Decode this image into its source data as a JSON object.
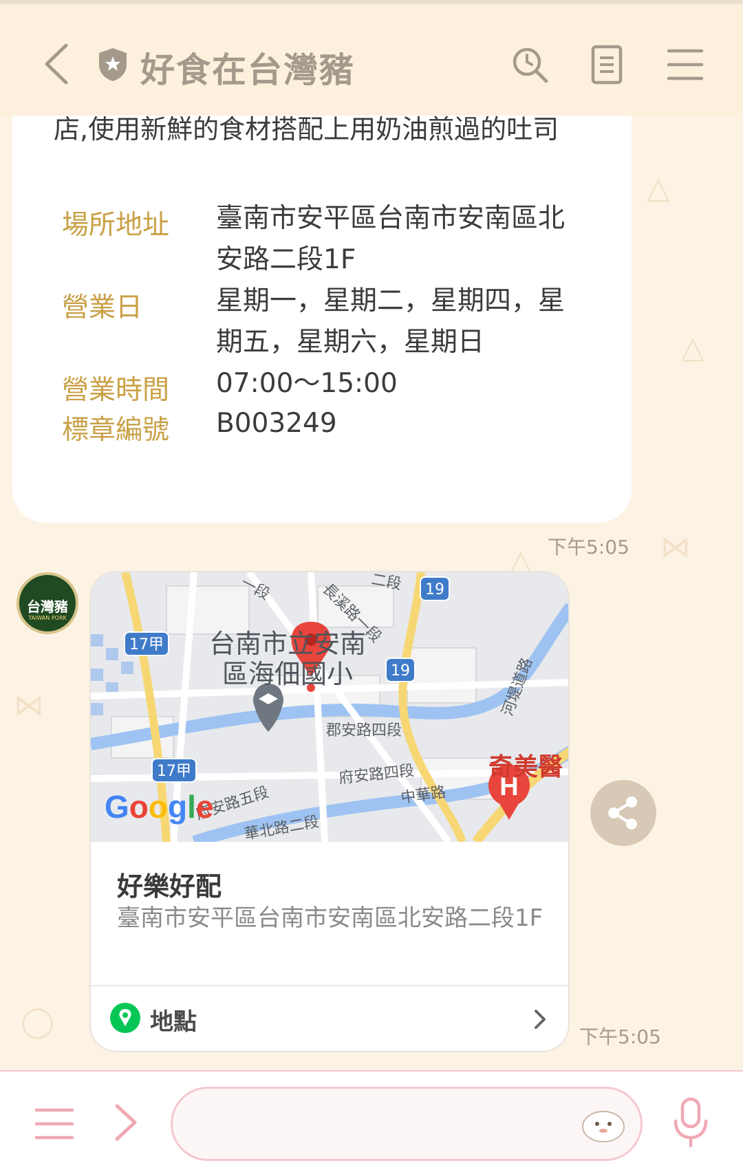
{
  "header": {
    "title": "好食在台灣豬"
  },
  "info_card": {
    "description": "店,使用新鮮的食材搭配上用奶油煎過的吐司",
    "rows": [
      {
        "label": "場所地址",
        "value": "臺南市安平區台南市安南區北安路二段1F"
      },
      {
        "label": "營業日",
        "value": "星期一，星期二，星期四，星期五，星期六，星期日"
      },
      {
        "label": "營業時間",
        "value": "07:00～15:00"
      },
      {
        "label": "標章編號",
        "value": "B003249"
      }
    ],
    "time": "下午5:05"
  },
  "avatar": {
    "text": "台灣豬",
    "sub": "TAIWAN PORK"
  },
  "location_card": {
    "map": {
      "school_name": "台南市立安南區海佃國小",
      "hospital_name": "奇美醫",
      "road_labels": [
        "郡安路四段",
        "府安路四段",
        "中華路",
        "長溪路一段",
        "府安路五段",
        "河堤道路",
        "華北路二段",
        "一段",
        "二段"
      ],
      "route_numbers": [
        "19",
        "19",
        "17甲",
        "17甲"
      ],
      "google_letters": [
        "G",
        "o",
        "o",
        "g",
        "l",
        "e"
      ],
      "google_colors": [
        "#4285f4",
        "#ea4335",
        "#fbbc05",
        "#4285f4",
        "#34a853",
        "#ea4335"
      ]
    },
    "name": "好樂好配",
    "address": "臺南市安平區台南市安南區北安路二段1F",
    "link_label": "地點",
    "time": "下午5:05"
  },
  "input": {
    "value": "",
    "placeholder": ""
  },
  "colors": {
    "label_gold": "#c9a046",
    "line_green": "#06c755",
    "accent_pink": "#f0a8b4"
  }
}
